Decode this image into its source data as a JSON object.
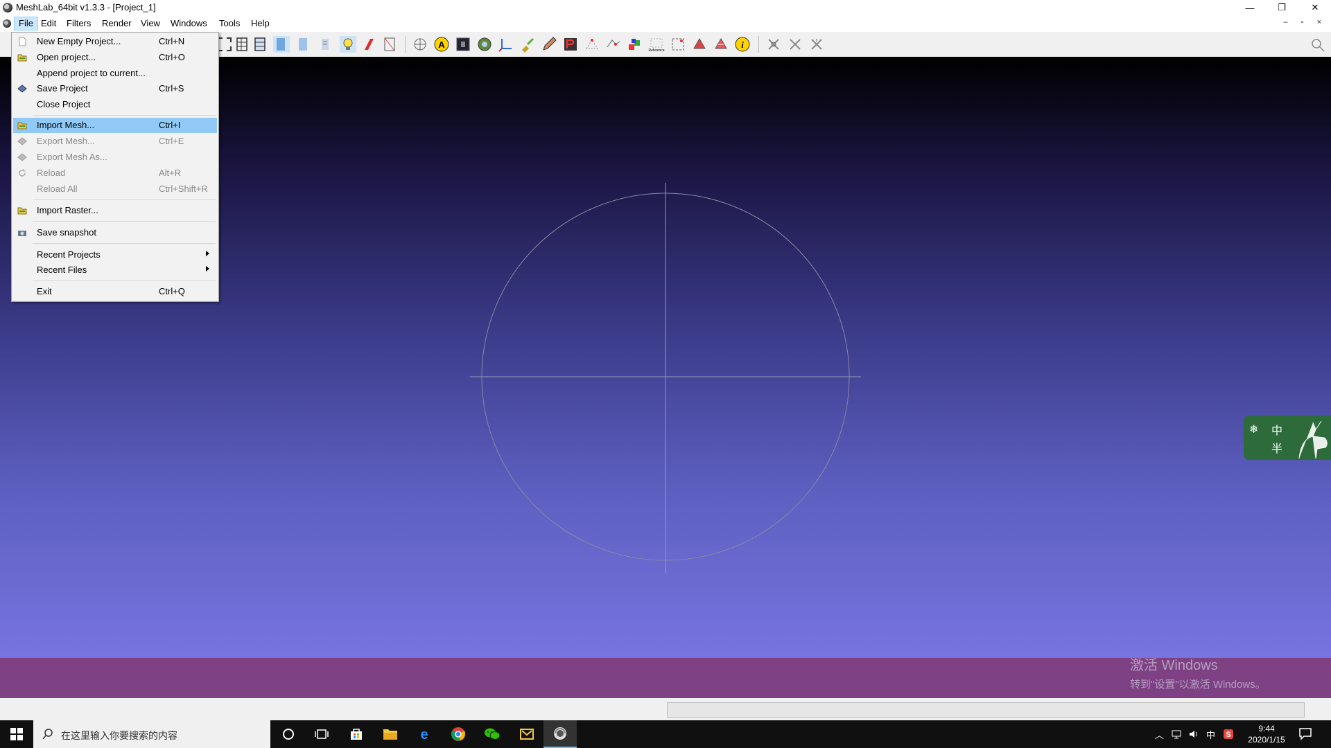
{
  "window": {
    "title": "MeshLab_64bit v1.3.3 - [Project_1]",
    "controls": {
      "minimize": "—",
      "maximize": "❐",
      "close": "✕"
    }
  },
  "menubar": {
    "items": [
      "File",
      "Edit",
      "Filters",
      "Render",
      "View",
      "Windows",
      "Tools",
      "Help"
    ],
    "active": "File",
    "mdi_controls": "– ▫ ×"
  },
  "file_menu": {
    "items": [
      {
        "label": "New Empty Project...",
        "shortcut": "Ctrl+N",
        "icon": "new-doc-icon",
        "disabled": false
      },
      {
        "label": "Open project...",
        "shortcut": "Ctrl+O",
        "icon": "open-folder-icon",
        "disabled": false
      },
      {
        "label": "Append project to current...",
        "shortcut": "",
        "icon": "",
        "disabled": false
      },
      {
        "label": "Save Project",
        "shortcut": "Ctrl+S",
        "icon": "save-icon",
        "disabled": false
      },
      {
        "label": "Close Project",
        "shortcut": "",
        "icon": "",
        "disabled": false
      },
      {
        "label": "Import Mesh...",
        "shortcut": "Ctrl+I",
        "icon": "import-folder-icon",
        "disabled": false,
        "highlighted": true
      },
      {
        "label": "Export Mesh...",
        "shortcut": "Ctrl+E",
        "icon": "export-icon",
        "disabled": true
      },
      {
        "label": "Export Mesh As...",
        "shortcut": "",
        "icon": "export-as-icon",
        "disabled": true
      },
      {
        "label": "Reload",
        "shortcut": "Alt+R",
        "icon": "reload-icon",
        "disabled": true
      },
      {
        "label": "Reload All",
        "shortcut": "Ctrl+Shift+R",
        "icon": "",
        "disabled": true
      },
      {
        "label": "Import Raster...",
        "shortcut": "",
        "icon": "raster-folder-icon",
        "disabled": false
      },
      {
        "label": "Save snapshot",
        "shortcut": "",
        "icon": "camera-icon",
        "disabled": false
      },
      {
        "label": "Recent Projects",
        "shortcut": "",
        "icon": "",
        "disabled": false,
        "submenu": true
      },
      {
        "label": "Recent Files",
        "shortcut": "",
        "icon": "",
        "disabled": false,
        "submenu": true
      },
      {
        "label": "Exit",
        "shortcut": "Ctrl+Q",
        "icon": "",
        "disabled": false
      }
    ]
  },
  "watermark": {
    "line1": "激活 Windows",
    "line2": "转到\"设置\"以激活 Windows。"
  },
  "ime_widget": {
    "line1": "中",
    "line2": "半"
  },
  "taskbar": {
    "search_placeholder": "在这里输入你要搜索的内容",
    "tray_lang": "中",
    "time": "9:44",
    "date": "2020/1/15"
  },
  "colors": {
    "viewport_top": "#000000",
    "viewport_bottom": "#7774e0",
    "bottom_strip": "#7e4184",
    "menu_highlight": "#91c9f7",
    "taskbar": "#101010"
  }
}
